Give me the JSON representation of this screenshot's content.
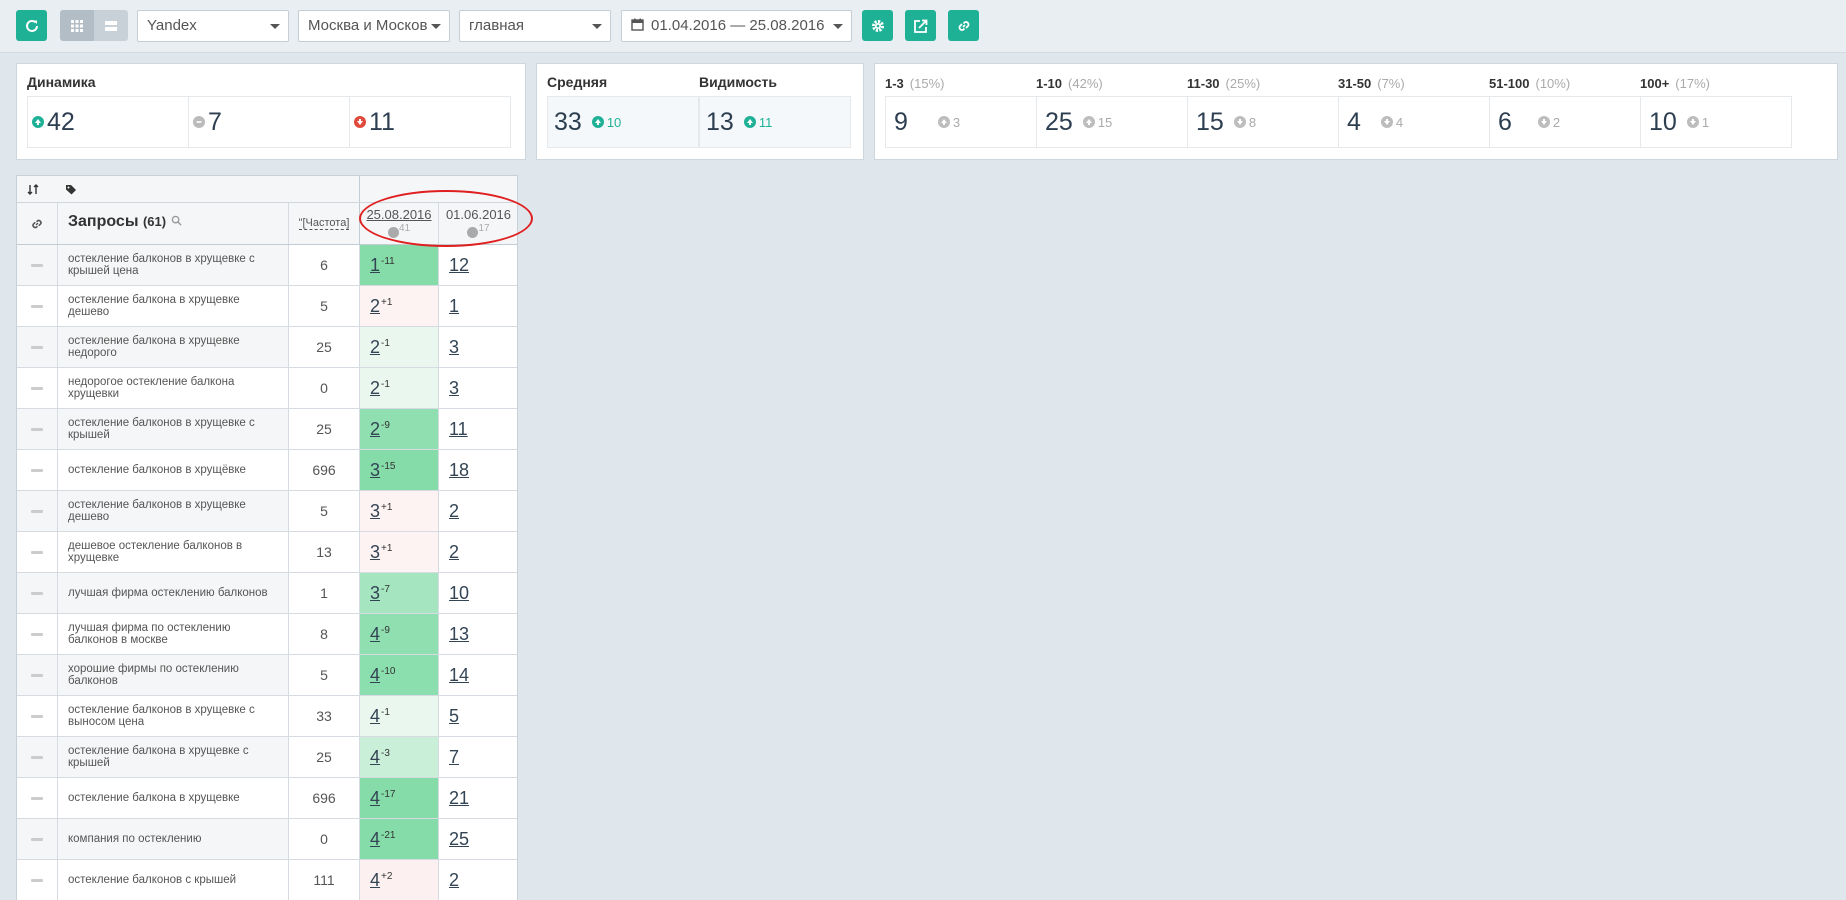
{
  "toolbar": {
    "engine": "Yandex",
    "region": "Москва и Москов",
    "page": "главная",
    "daterange": "01.04.2016 — 25.08.2016"
  },
  "dynamics": {
    "title": "Динамика",
    "up": "42",
    "neutral": "7",
    "down": "11"
  },
  "average": {
    "title_avg": "Средняя",
    "title_vis": "Видимость",
    "avg_value": "33",
    "avg_delta": "10",
    "vis_value": "13",
    "vis_delta": "11"
  },
  "ranges": [
    {
      "label": "1-3",
      "pct": "(15%)",
      "value": "9",
      "delta": "3",
      "dir": "up"
    },
    {
      "label": "1-10",
      "pct": "(42%)",
      "value": "25",
      "delta": "15",
      "dir": "up"
    },
    {
      "label": "11-30",
      "pct": "(25%)",
      "value": "15",
      "delta": "8",
      "dir": "down"
    },
    {
      "label": "31-50",
      "pct": "(7%)",
      "value": "4",
      "delta": "4",
      "dir": "down"
    },
    {
      "label": "51-100",
      "pct": "(10%)",
      "value": "6",
      "delta": "2",
      "dir": "down"
    },
    {
      "label": "100+",
      "pct": "(17%)",
      "value": "10",
      "delta": "1",
      "dir": "down"
    }
  ],
  "table": {
    "queries_label": "Запросы",
    "queries_count": "(61)",
    "freq_label": "\"[Частота]",
    "date1": "25.08.2016",
    "date1_sub": "41",
    "date2": "01.06.2016",
    "date2_sub": "17",
    "rows": [
      {
        "q": "остекление балконов в хрущевке с крышей цена",
        "f": "6",
        "p1": "1",
        "d": "-11",
        "p2": "12",
        "bg": "#85dca9"
      },
      {
        "q": "остекление балкона в хрущевке дешево",
        "f": "5",
        "p1": "2",
        "d": "+1",
        "p2": "1",
        "bg": "#fdf3f3"
      },
      {
        "q": "остекление балкона в хрущевке недорого",
        "f": "25",
        "p1": "2",
        "d": "-1",
        "p2": "3",
        "bg": "#e9f7ef"
      },
      {
        "q": "недорогое остекление балкона хрущевки",
        "f": "0",
        "p1": "2",
        "d": "-1",
        "p2": "3",
        "bg": "#e9f7ef"
      },
      {
        "q": "остекление балконов в хрущевке с крышей",
        "f": "25",
        "p1": "2",
        "d": "-9",
        "p2": "11",
        "bg": "#90dfb1"
      },
      {
        "q": "остекление балконов в хрущёвке",
        "f": "696",
        "p1": "3",
        "d": "-15",
        "p2": "18",
        "bg": "#85dca9"
      },
      {
        "q": "остекление балконов в хрущевке дешево",
        "f": "5",
        "p1": "3",
        "d": "+1",
        "p2": "2",
        "bg": "#fdf3f3"
      },
      {
        "q": "дешевое остекление балконов в хрущевке",
        "f": "13",
        "p1": "3",
        "d": "+1",
        "p2": "2",
        "bg": "#fdf3f3"
      },
      {
        "q": "лучшая фирма остеклению балконов",
        "f": "1",
        "p1": "3",
        "d": "-7",
        "p2": "10",
        "bg": "#a5e6c0"
      },
      {
        "q": "лучшая фирма по остеклению балконов в москве",
        "f": "8",
        "p1": "4",
        "d": "-9",
        "p2": "13",
        "bg": "#90dfb1"
      },
      {
        "q": "хорошие фирмы по остеклению балконов",
        "f": "5",
        "p1": "4",
        "d": "-10",
        "p2": "14",
        "bg": "#8bdead"
      },
      {
        "q": "остекление балконов в хрущевке с выносом цена",
        "f": "33",
        "p1": "4",
        "d": "-1",
        "p2": "5",
        "bg": "#e9f7ef"
      },
      {
        "q": "остекление балкона в хрущевке с крышей",
        "f": "25",
        "p1": "4",
        "d": "-3",
        "p2": "7",
        "bg": "#c9efd8"
      },
      {
        "q": "остекление балкона в хрущевке",
        "f": "696",
        "p1": "4",
        "d": "-17",
        "p2": "21",
        "bg": "#85dca9"
      },
      {
        "q": "компания по остеклению",
        "f": "0",
        "p1": "4",
        "d": "-21",
        "p2": "25",
        "bg": "#85dca9"
      },
      {
        "q": "остекление балконов с крышей",
        "f": "111",
        "p1": "4",
        "d": "+2",
        "p2": "2",
        "bg": "#fdf0f0"
      }
    ]
  }
}
